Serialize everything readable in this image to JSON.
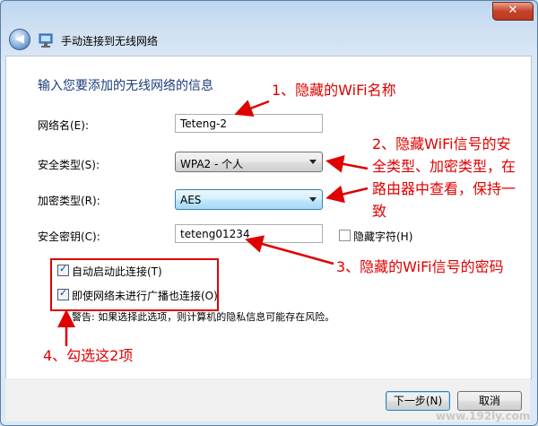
{
  "window": {
    "title": "手动连接到无线网络",
    "close_glyph": "✕",
    "back_glyph": "◀"
  },
  "heading": "输入您要添加的无线网络的信息",
  "form": {
    "network_name_label": "网络名(E):",
    "network_name_value": "Teteng-2",
    "security_type_label": "安全类型(S):",
    "security_type_value": "WPA2 - 个人",
    "encryption_type_label": "加密类型(R):",
    "encryption_type_value": "AES",
    "security_key_label": "安全密钥(C):",
    "security_key_value": "teteng01234",
    "hide_chars_label": "隐藏字符(H)",
    "hide_chars_checked": false
  },
  "options": {
    "auto_connect_label": "自动启动此连接(T)",
    "auto_connect_checked": true,
    "connect_not_broadcast_label": "即使网络未进行广播也连接(O)",
    "connect_not_broadcast_checked": true,
    "warning": "警告: 如果选择此选项，则计算机的隐私信息可能存在风险。"
  },
  "buttons": {
    "next": "下一步(N)",
    "cancel": "取消"
  },
  "annotations": {
    "note1": "1、隐藏的WiFi名称",
    "note2_line1": "2、隐藏WiFi信号的安",
    "note2_line2": "全类型、加密类型，在",
    "note2_line3": "路由器中查看，保持一",
    "note2_line4": "致",
    "note3": "3、隐藏的WiFi信号的密码",
    "note4": "4、勾选这2项",
    "color": "#e00000"
  },
  "watermark": "www.192ly.com"
}
